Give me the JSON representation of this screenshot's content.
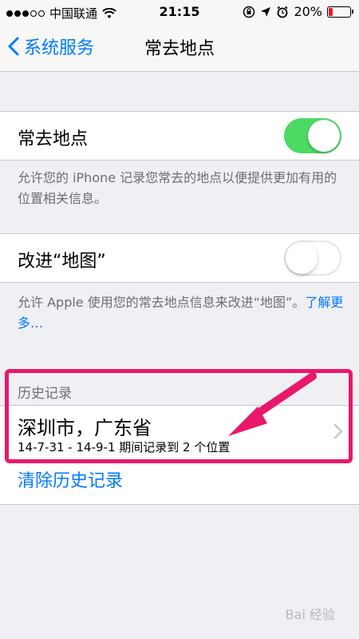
{
  "status_bar": {
    "carrier": "中国联通",
    "time": "21:15",
    "battery": "20%",
    "battery_level": 0.2
  },
  "nav": {
    "back_label": "系统服务",
    "title": "常去地点"
  },
  "frequent_locations": {
    "label": "常去地点",
    "toggle_on": true,
    "description": "允许您的 iPhone 记录您常去的地点以便提供更加有用的位置相关信息。"
  },
  "improve_maps": {
    "label": "改进“地图”",
    "toggle_on": false,
    "description": "允许 Apple 使用您的常去地点信息来改进“地图”。",
    "learn_more": "了解更多…"
  },
  "history": {
    "header": "历史记录",
    "items": [
      {
        "title": "深圳市，广东省",
        "subtitle": "14-7-31 - 14-9-1 期间记录到 2 个位置"
      }
    ],
    "clear_label": "清除历史记录"
  },
  "annotation_color": "#e8186c",
  "watermark": "Bai 经验"
}
